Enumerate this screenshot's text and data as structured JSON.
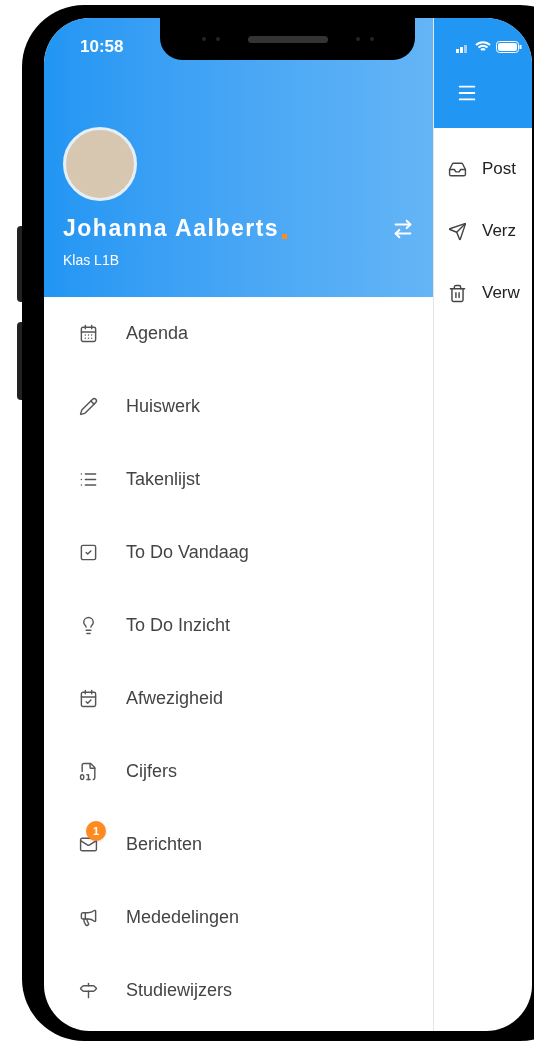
{
  "status_bar": {
    "time": "10:58"
  },
  "profile": {
    "name": "Johanna Aalberts",
    "class": "Klas L1B"
  },
  "menu": [
    {
      "label": "Agenda"
    },
    {
      "label": "Huiswerk"
    },
    {
      "label": "Takenlijst"
    },
    {
      "label": "To Do Vandaag"
    },
    {
      "label": "To Do Inzicht"
    },
    {
      "label": "Afwezigheid"
    },
    {
      "label": "Cijfers"
    },
    {
      "label": "Berichten",
      "badge": "1"
    },
    {
      "label": "Mededelingen"
    },
    {
      "label": "Studiewijzers"
    }
  ],
  "mail_panel": {
    "folders": [
      {
        "label": "Post"
      },
      {
        "label": "Verz"
      },
      {
        "label": "Verw"
      }
    ]
  }
}
